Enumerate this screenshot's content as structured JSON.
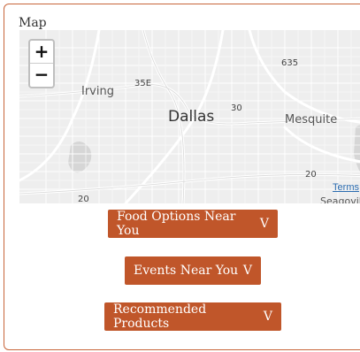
{
  "panel": {
    "title": "Map"
  },
  "map": {
    "zoom_in": "+",
    "zoom_out": "−",
    "labels": {
      "irving": "Irving",
      "dallas": "Dallas",
      "mesquite": "Mesquite",
      "seagoville": "Seagoville",
      "route_35e": "35E",
      "route_30": "30",
      "route_635": "635",
      "route_20_bottom_left": "20",
      "route_20_right": "20"
    },
    "terms_link": "Terms"
  },
  "buttons": {
    "food_options": {
      "label": "Food Options Near You",
      "chevron": "V"
    },
    "events": {
      "label": "Events Near You",
      "chevron": "V"
    },
    "products": {
      "label": "Recommended Products",
      "chevron": "V"
    }
  },
  "colors": {
    "accent": "#c0562a",
    "border": "#c8653a",
    "map_bg": "#eeeeee"
  }
}
